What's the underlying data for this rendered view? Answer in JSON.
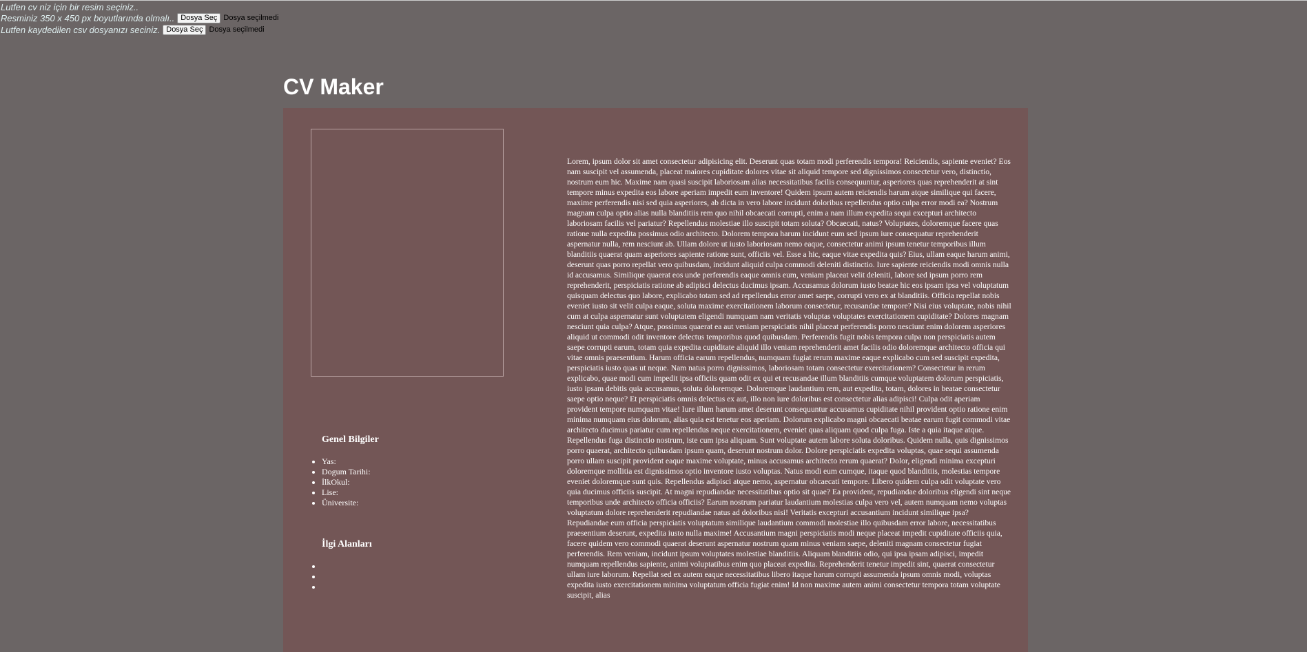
{
  "uploads": [
    {
      "label": "Lutfen cv niz için bir resim seçiniz.."
    },
    {
      "label": "Resminiz 350 x 450 px boyutlarında olmalı..",
      "button": "Dosya Seç",
      "status": "Dosya seçilmedi"
    },
    {
      "label": "Lutfen kaydedilen csv dosyanızı seciniz.",
      "button": "Dosya Seç",
      "status": "Dosya seçilmedi"
    }
  ],
  "page": {
    "title": "CV Maker"
  },
  "cv": {
    "general_title": "Genel Bilgiler",
    "general_items": [
      "Yas:",
      "Dogum Tarihi:",
      "İlkOkul:",
      "Lise:",
      "Üniversite:"
    ],
    "interests_title": "İlgi Alanları",
    "interests_items": [
      "",
      "",
      ""
    ],
    "body_text": "Lorem, ipsum dolor sit amet consectetur adipisicing elit. Deserunt quas totam modi perferendis tempora! Reiciendis, sapiente eveniet? Eos nam suscipit vel assumenda, placeat maiores cupiditate dolores vitae sit aliquid tempore sed dignissimos consectetur vero, distinctio, nostrum eum hic. Maxime nam quasi suscipit laboriosam alias necessitatibus facilis consequuntur, asperiores quas reprehenderit at sint tempore minus expedita eos labore aperiam impedit eum inventore! Quidem ipsum autem reiciendis harum atque similique qui facere, maxime perferendis nisi sed quia asperiores, ab dicta in vero labore incidunt doloribus repellendus optio culpa error modi ea? Nostrum magnam culpa optio alias nulla blanditiis rem quo nihil obcaecati corrupti, enim a nam illum expedita sequi excepturi architecto laboriosam facilis vel pariatur? Repellendus molestiae illo suscipit totam soluta? Obcaecati, natus? Voluptates, doloremque facere quas ratione nulla expedita possimus odio architecto. Dolorem tempora harum incidunt eum sed ipsum iure consequatur reprehenderit aspernatur nulla, rem nesciunt ab. Ullam dolore ut iusto laboriosam nemo eaque, consectetur animi ipsum tenetur temporibus illum blanditiis quaerat quam asperiores sapiente ratione sunt, officiis vel. Esse a hic, eaque vitae expedita quis? Eius, ullam eaque harum animi, deserunt quas porro repellat vero quibusdam, incidunt aliquid culpa commodi deleniti distinctio. Iure sapiente reiciendis modi omnis nulla id accusamus. Similique quaerat eos unde perferendis eaque omnis eum, veniam placeat velit deleniti, labore sed ipsum porro rem reprehenderit, perspiciatis ratione ab adipisci delectus ducimus ipsam. Accusamus dolorum iusto beatae hic eos ipsam ipsa vel voluptatum quisquam delectus quo labore, explicabo totam sed ad repellendus error amet saepe, corrupti vero ex at blanditiis. Officia repellat nobis eveniet iusto sit velit culpa eaque, soluta maxime exercitationem laborum consectetur, recusandae tempore? Nisi eius voluptate, nobis nihil cum at culpa aspernatur sunt voluptatem eligendi numquam nam veritatis voluptas voluptates exercitationem cupiditate? Dolores magnam nesciunt quia culpa? Atque, possimus quaerat ea aut veniam perspiciatis nihil placeat perferendis porro nesciunt enim dolorem asperiores aliquid ut commodi odit inventore delectus temporibus quod quibusdam. Perferendis fugit nobis tempora culpa non perspiciatis autem saepe corrupti earum, totam quia expedita cupiditate aliquid illo veniam reprehenderit amet facilis odio doloremque architecto officia qui vitae omnis praesentium. Harum officia earum repellendus, numquam fugiat rerum maxime eaque explicabo cum sed suscipit expedita, perspiciatis iusto quas ut neque. Nam natus porro dignissimos, laboriosam totam consectetur exercitationem? Consectetur in rerum explicabo, quae modi cum impedit ipsa officiis quam odit ex qui et recusandae illum blanditiis cumque voluptatem dolorum perspiciatis, iusto ipsam debitis quia accusamus, soluta doloremque. Doloremque laudantium rem, aut expedita, totam, dolores in beatae consectetur saepe optio neque? Et perspiciatis omnis delectus ex aut, illo non iure doloribus est consectetur alias adipisci! Culpa odit aperiam provident tempore numquam vitae! Iure illum harum amet deserunt consequuntur accusamus cupiditate nihil provident optio ratione enim minima numquam eius dolorum, alias quia est tenetur eos aperiam. Dolorum explicabo magni obcaecati beatae earum fugit commodi vitae architecto ducimus pariatur cum repellendus neque exercitationem, eveniet quas aliquam quod culpa fuga. Iste a quia itaque atque. Repellendus fuga distinctio nostrum, iste cum ipsa aliquam. Sunt voluptate autem labore soluta doloribus. Quidem nulla, quis dignissimos porro quaerat, architecto quibusdam ipsum quam, deserunt nostrum dolor. Dolore perspiciatis expedita voluptas, quae sequi assumenda porro ullam suscipit provident eaque maxime voluptate, minus accusamus architecto rerum quaerat? Dolor, eligendi minima excepturi doloremque mollitia est dignissimos optio inventore iusto voluptas. Natus modi eum cumque, itaque quod blanditiis, molestias tempore eveniet doloremque sunt quis. Repellendus adipisci atque nemo, aspernatur obcaecati tempore. Libero quidem culpa odit voluptate vero quia ducimus officiis suscipit. At magni repudiandae necessitatibus optio sit quae? Ea provident, repudiandae doloribus eligendi sint neque temporibus unde architecto officia officiis? Earum nostrum pariatur laudantium molestias culpa vero vel, autem numquam nemo voluptas voluptatum dolore reprehenderit repudiandae natus ad doloribus nisi! Veritatis excepturi accusantium incidunt similique ipsa? Repudiandae eum officia perspiciatis voluptatum similique laudantium commodi molestiae illo quibusdam error labore, necessitatibus praesentium deserunt, expedita iusto nulla maxime! Accusantium magni perspiciatis modi neque placeat impedit cupiditate officiis quia, facere quidem vero commodi quaerat deserunt aspernatur nostrum quam minus veniam saepe, deleniti magnam consectetur fugiat perferendis. Rem veniam, incidunt ipsum voluptates molestiae blanditiis. Aliquam blanditiis odio, qui ipsa ipsam adipisci, impedit numquam repellendus sapiente, animi voluptatibus enim quo placeat expedita. Reprehenderit tenetur impedit sint, quaerat consectetur ullam iure laborum. Repellat sed ex autem eaque necessitatibus libero itaque harum corrupti assumenda ipsum omnis modi, voluptas expedita iusto exercitationem minima voluptatum officia fugiat enim! Id non maxime autem animi consectetur tempora totam voluptate suscipit, alias"
  }
}
